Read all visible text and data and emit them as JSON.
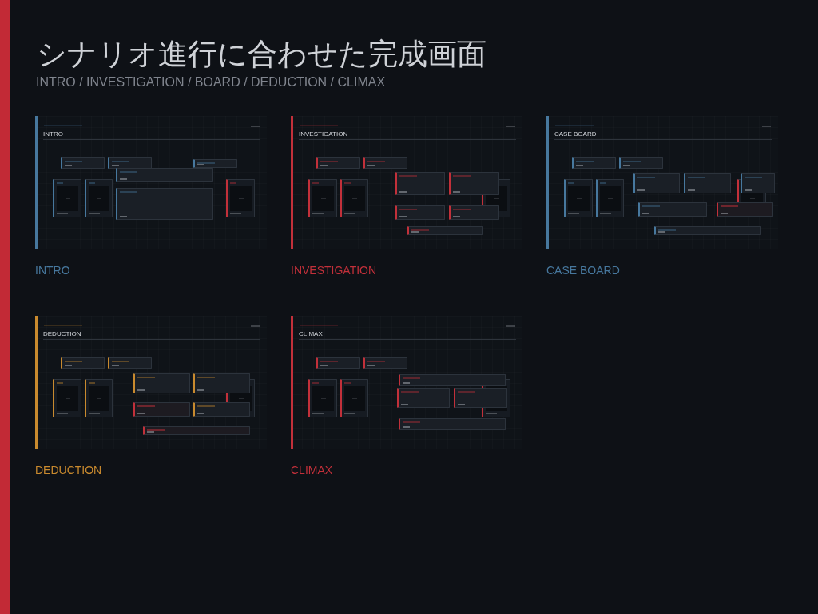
{
  "title": "シナリオ進行に合わせた完成画面",
  "subtitle": "INTRO / INVESTIGATION / BOARD / DEDUCTION / CLIMAX",
  "screens": [
    {
      "screen_title": "INTRO",
      "caption": "INTRO",
      "color": "#47789e",
      "panels": [
        {
          "kind": "info",
          "flagged": false
        },
        {
          "kind": "info",
          "flagged": false
        },
        {
          "kind": "info",
          "flagged": false
        },
        {
          "kind": "info",
          "flagged": false
        },
        {
          "kind": "portrait",
          "flagged": false
        },
        {
          "kind": "portrait",
          "flagged": false
        },
        {
          "kind": "info",
          "flagged": false
        },
        {
          "kind": "portrait",
          "flagged": true
        }
      ]
    },
    {
      "screen_title": "INVESTIGATION",
      "caption": "INVESTIGATION",
      "color": "#c2303a",
      "panels": [
        {
          "kind": "info"
        },
        {
          "kind": "info"
        },
        {
          "kind": "portrait"
        },
        {
          "kind": "portrait"
        },
        {
          "kind": "portrait"
        },
        {
          "kind": "info"
        },
        {
          "kind": "info"
        },
        {
          "kind": "info"
        },
        {
          "kind": "info"
        },
        {
          "kind": "info"
        }
      ]
    },
    {
      "screen_title": "CASE BOARD",
      "caption": "CASE BOARD",
      "color": "#47789e",
      "panels": [
        {
          "kind": "info",
          "flagged": false
        },
        {
          "kind": "info",
          "flagged": false
        },
        {
          "kind": "portrait",
          "flagged": false
        },
        {
          "kind": "portrait",
          "flagged": false
        },
        {
          "kind": "portrait",
          "flagged": true
        },
        {
          "kind": "info",
          "flagged": false
        },
        {
          "kind": "info",
          "flagged": false
        },
        {
          "kind": "info",
          "flagged": false
        },
        {
          "kind": "info",
          "flagged": false
        },
        {
          "kind": "info",
          "flagged": true
        },
        {
          "kind": "info",
          "flagged": false
        }
      ]
    },
    {
      "screen_title": "DEDUCTION",
      "caption": "DEDUCTION",
      "color": "#c98a2e",
      "panels": [
        {
          "kind": "info",
          "flagged": false
        },
        {
          "kind": "info",
          "flagged": false
        },
        {
          "kind": "portrait",
          "flagged": false
        },
        {
          "kind": "portrait",
          "flagged": false
        },
        {
          "kind": "portrait",
          "flagged": true
        },
        {
          "kind": "info",
          "flagged": false
        },
        {
          "kind": "info",
          "flagged": false
        },
        {
          "kind": "info",
          "flagged": true
        },
        {
          "kind": "info",
          "flagged": false
        },
        {
          "kind": "info",
          "flagged": true
        }
      ]
    },
    {
      "screen_title": "CLIMAX",
      "caption": "CLIMAX",
      "color": "#c2303a",
      "panels": [
        {
          "kind": "info"
        },
        {
          "kind": "info"
        },
        {
          "kind": "portrait"
        },
        {
          "kind": "portrait"
        },
        {
          "kind": "portrait"
        },
        {
          "kind": "info"
        },
        {
          "kind": "info"
        },
        {
          "kind": "info"
        },
        {
          "kind": "info"
        }
      ]
    }
  ]
}
